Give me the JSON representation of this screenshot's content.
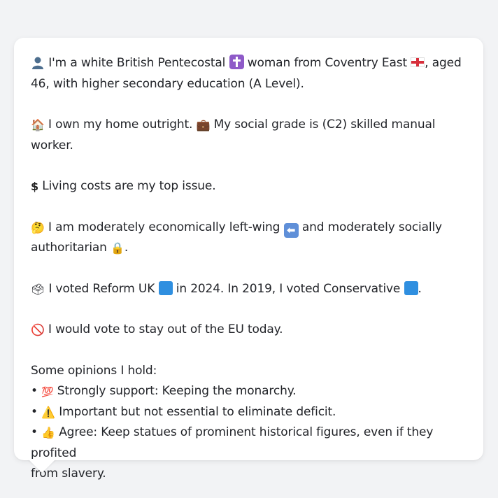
{
  "colors": {
    "background": "#f2f3f5",
    "card": "#ffffff",
    "text": "#23252a",
    "reform_square": "#2f8fe0",
    "conservative_square": "#2f8fe0"
  },
  "lines": {
    "identity_1": "I'm a white British Pentecostal",
    "identity_2": "woman from Coventry East",
    "identity_3": ", aged",
    "identity_4": "46, with higher secondary education (A Level).",
    "home_1": "I own my home outright.",
    "home_2": "My social grade is (C2) skilled manual worker.",
    "issue": "Living costs are my top issue.",
    "politics_1": "I am moderately economically left-wing",
    "politics_2": "and moderately socially",
    "politics_3": "authoritarian",
    "politics_4": ".",
    "vote_1": "I voted Reform UK",
    "vote_2": "in 2024. In 2019, I voted Conservative",
    "vote_3": ".",
    "eu": "I would vote to stay out of the EU today."
  },
  "opinions": {
    "heading": "Some opinions I hold:",
    "bullet": "•",
    "items": [
      "Strongly support: Keeping the monarchy.",
      "Important but not essential to eliminate deficit.",
      "Agree: Keep statues of prominent historical figures, even if they profited",
      "from slavery."
    ]
  },
  "icons": {
    "identity": "person-icon",
    "religion": "latin-cross-icon",
    "flag": "england-flag-icon",
    "home": "house-icon",
    "job": "briefcase-icon",
    "issue": "dollar-sign-icon",
    "thinking": "thinking-face-icon",
    "economic": "left-arrow-icon",
    "social": "padlock-icon",
    "vote": "ballot-box-icon",
    "party_2024": "blue-square-icon",
    "party_2019": "blue-square-icon",
    "eu": "prohibited-icon",
    "strongly_support": "hundred-points-icon",
    "important": "warning-icon",
    "agree": "thumbs-up-icon"
  }
}
